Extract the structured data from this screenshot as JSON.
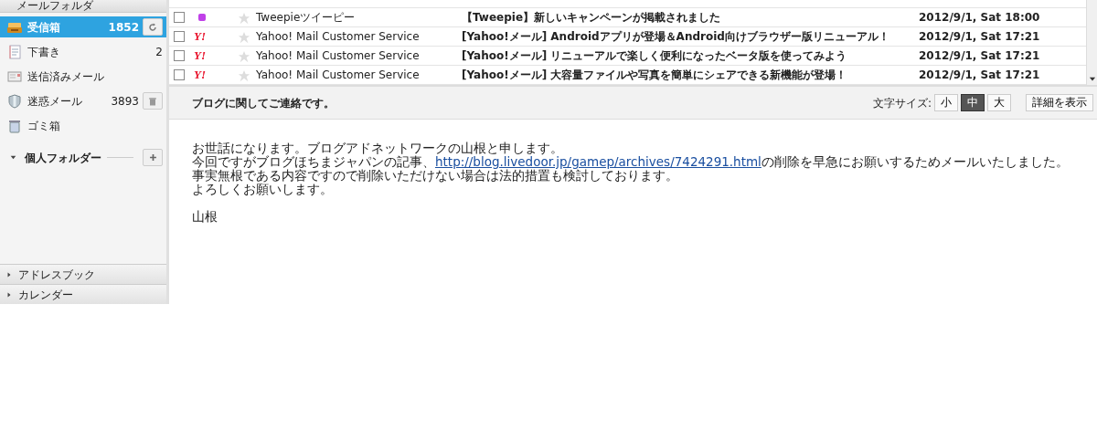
{
  "sidebar": {
    "header": "メールフォルダ",
    "folders": [
      {
        "kind": "inbox",
        "label": "受信箱",
        "count": "1852",
        "selected": true
      },
      {
        "kind": "draft",
        "label": "下書き",
        "count": "2",
        "selected": false
      },
      {
        "kind": "sent",
        "label": "送信済みメール",
        "selected": false
      },
      {
        "kind": "spam",
        "label": "迷惑メール",
        "count": "3893",
        "selected": false
      },
      {
        "kind": "trash",
        "label": "ゴミ箱",
        "selected": false
      }
    ],
    "personal": {
      "label": "個人フォルダー",
      "expanded": true
    },
    "bottom": [
      {
        "label": "アドレスブック",
        "expanded": false
      },
      {
        "label": "カレンダー",
        "expanded": false
      }
    ]
  },
  "messages": [
    {
      "kind": "dot",
      "color": "#c040e8",
      "checked": false,
      "starred": false,
      "from": "Tweepieツイーピー",
      "subject": "【Tweepie】新しいキャンペーンが掲載されました",
      "date": "2012/9/1, Sat 18:00"
    },
    {
      "kind": "logo",
      "logo": "Y!",
      "checked": false,
      "starred": false,
      "from": "Yahoo! Mail Customer Service",
      "subject": "[Yahoo!メール] Androidアプリが登場＆Android向けブラウザー版リニューアル！",
      "date": "2012/9/1, Sat 17:21"
    },
    {
      "kind": "logo",
      "logo": "Y!",
      "checked": false,
      "starred": false,
      "from": "Yahoo! Mail Customer Service",
      "subject": "[Yahoo!メール] リニューアルで楽しく便利になったベータ版を使ってみよう",
      "date": "2012/9/1, Sat 17:21"
    },
    {
      "kind": "logo",
      "logo": "Y!",
      "checked": false,
      "starred": false,
      "from": "Yahoo! Mail Customer Service",
      "subject": "[Yahoo!メール] 大容量ファイルや写真を簡単にシェアできる新機能が登場！",
      "date": "2012/9/1, Sat 17:21"
    }
  ],
  "preview": {
    "subject": "ブログに関してご連絡です。",
    "font_size_label": "文字サイズ:",
    "font_sizes": [
      {
        "label": "小",
        "selected": false
      },
      {
        "label": "中",
        "selected": true
      },
      {
        "label": "大",
        "selected": false
      }
    ],
    "details_button": "詳細を表示",
    "body": [
      {
        "text": "お世話になります。ブログアドネットワークの山根と申します。"
      },
      {
        "before": "今回ですがブログほちまジャパンの記事、",
        "link": "http://blog.livedoor.jp/gamep/archives/7424291.html",
        "after": "の削除を早急にお願いするためメールいたしました。"
      },
      {
        "text": "事実無根である内容ですので削除いただけない場合は法的措置も検討しております。"
      },
      {
        "text": "よろしくお願いします。"
      }
    ],
    "signature": "山根"
  }
}
